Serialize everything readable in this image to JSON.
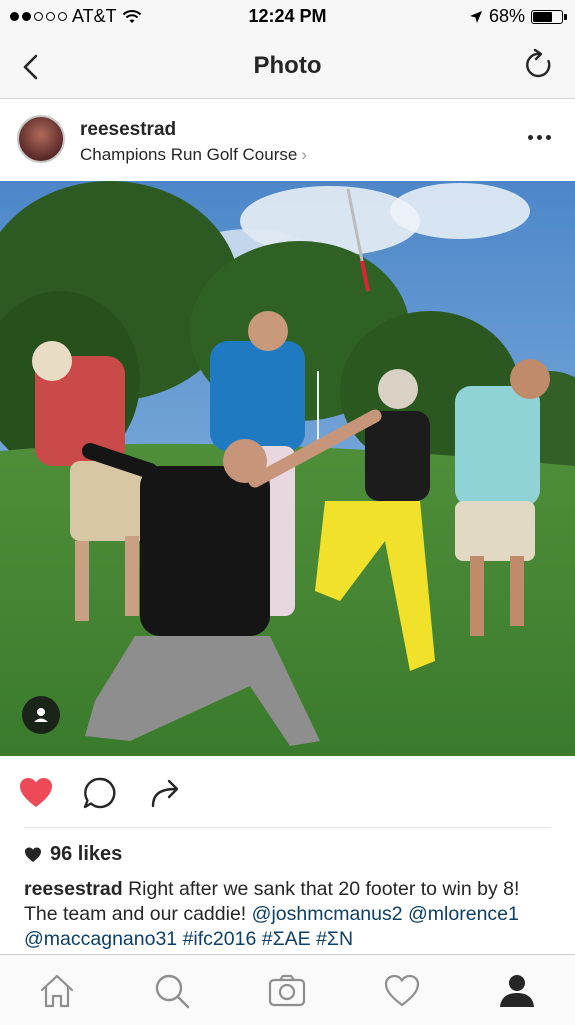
{
  "status_bar": {
    "carrier": "AT&T",
    "time": "12:24 PM",
    "battery": "68%",
    "battery_level": 0.68,
    "signal_bars_filled": 2,
    "signal_bars_total": 5
  },
  "nav": {
    "title": "Photo",
    "back_icon": "chevron-left-icon",
    "refresh_icon": "refresh-icon"
  },
  "post": {
    "username": "reesestrad",
    "location": "Champions Run Golf Course",
    "location_chevron": "›"
  },
  "actions": {
    "liked": true,
    "like_color": "#ed4956"
  },
  "likes": {
    "text": "96 likes"
  },
  "caption": {
    "username": "reesestrad",
    "text": "Right after we sank that 20 footer to win by 8! The team and our caddie!",
    "mentions": [
      "@joshmcmanus2",
      "@mlorence1",
      "@maccagnano31"
    ],
    "hashtags": [
      "#ifc2016",
      "#ΣAE",
      "#ΣN"
    ]
  },
  "tabbar": {
    "items": [
      "home-icon",
      "search-icon",
      "camera-icon",
      "heart-icon",
      "profile-icon"
    ],
    "active": "profile-icon"
  },
  "colors": {
    "link": "#0e3f66",
    "text": "#262626",
    "bar_bg": "#f7f7f7"
  }
}
